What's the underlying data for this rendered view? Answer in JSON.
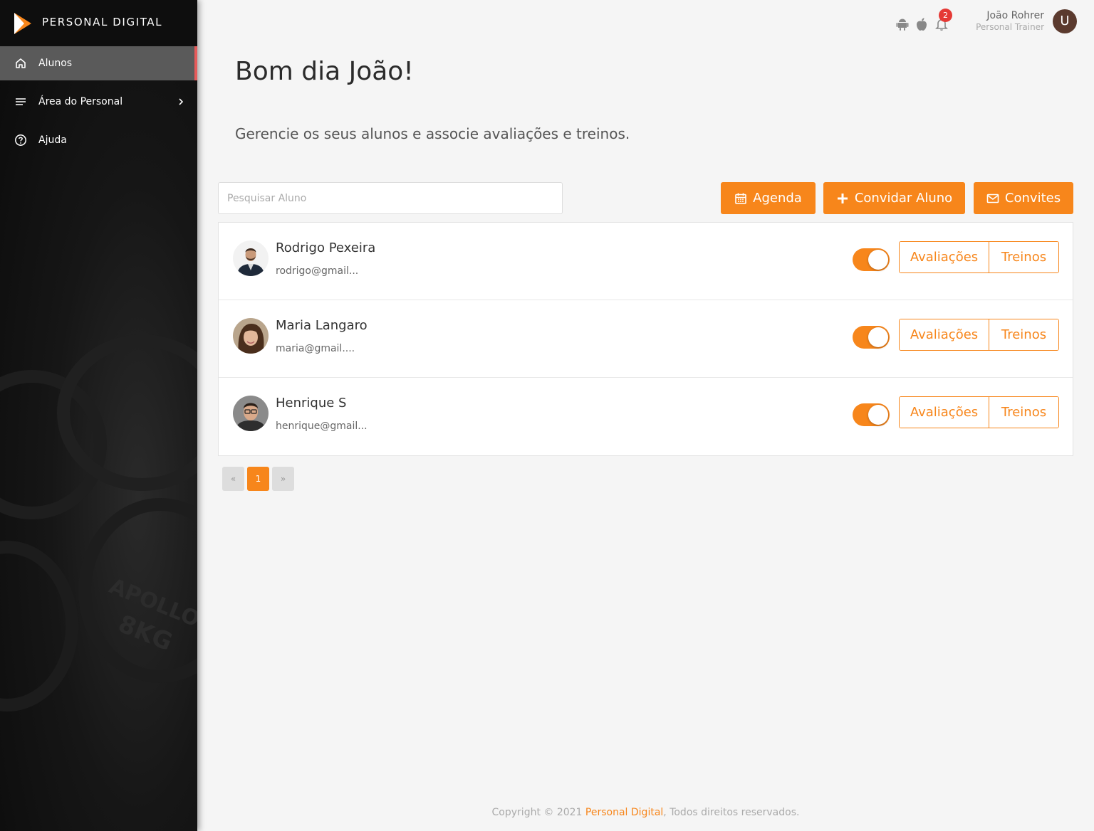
{
  "brand": {
    "name": "PERSONAL DIGITAL",
    "logo_icon": "play-logo-icon"
  },
  "sidebar": {
    "items": [
      {
        "label": "Alunos",
        "icon": "home-icon",
        "active": true
      },
      {
        "label": "Área do Personal",
        "icon": "menu-lines-icon",
        "active": false,
        "has_submenu": true
      },
      {
        "label": "Ajuda",
        "icon": "help-circle-icon",
        "active": false
      }
    ]
  },
  "topbar": {
    "notification_count": "2",
    "user": {
      "name": "João Rohrer",
      "role": "Personal Trainer",
      "avatar_letter": "U"
    },
    "icons": [
      "android-icon",
      "apple-icon",
      "bell-icon"
    ]
  },
  "main": {
    "greeting": "Bom dia João!",
    "subtitle": "Gerencie os seus alunos e associe avaliações e treinos.",
    "search": {
      "placeholder": "Pesquisar Aluno",
      "value": ""
    },
    "actions": {
      "agenda": "Agenda",
      "convidar": "Convidar Aluno",
      "convites": "Convites"
    },
    "students": [
      {
        "name": "Rodrigo Pexeira",
        "email": "rodrigo@gmail...",
        "active": true,
        "evaluations_label": "Avaliações",
        "workouts_label": "Treinos"
      },
      {
        "name": "Maria Langaro",
        "email": "maria@gmail....",
        "active": true,
        "evaluations_label": "Avaliações",
        "workouts_label": "Treinos"
      },
      {
        "name": "Henrique S",
        "email": "henrique@gmail...",
        "active": true,
        "evaluations_label": "Avaliações",
        "workouts_label": "Treinos"
      }
    ],
    "pagination": {
      "prev": "«",
      "current": "1",
      "next": "»"
    }
  },
  "footer": {
    "prefix": "Copyright © 2021 ",
    "link": "Personal Digital",
    "suffix": ", Todos direitos reservados."
  },
  "colors": {
    "accent": "#f7861b",
    "sidebar_bg": "#111111",
    "active_marker": "#e55a5a",
    "badge": "#e53935"
  }
}
